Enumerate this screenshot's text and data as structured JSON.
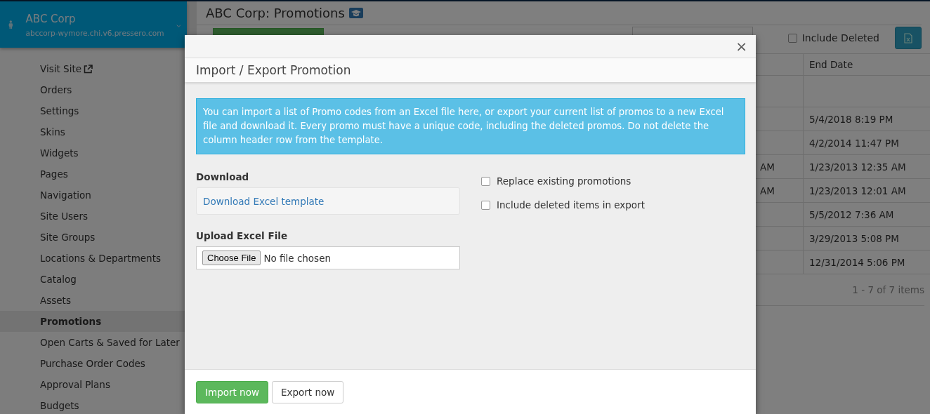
{
  "sidebar": {
    "account": {
      "name": "ABC Corp",
      "domain": "abccorp-wymore.chi.v6.pressero.com"
    },
    "items": [
      {
        "label": "Visit Site",
        "kind": "external",
        "selected": false
      },
      {
        "label": "Orders",
        "kind": "plain",
        "selected": false
      },
      {
        "label": "Settings",
        "kind": "plain",
        "selected": false
      },
      {
        "label": "Skins",
        "kind": "plain",
        "selected": false
      },
      {
        "label": "Widgets",
        "kind": "plain",
        "selected": false
      },
      {
        "label": "Pages",
        "kind": "plain",
        "selected": false
      },
      {
        "label": "Navigation",
        "kind": "plain",
        "selected": false
      },
      {
        "label": "Site Users",
        "kind": "plain",
        "selected": false
      },
      {
        "label": "Site Groups",
        "kind": "plain",
        "selected": false
      },
      {
        "label": "Locations & Departments",
        "kind": "plain",
        "selected": false
      },
      {
        "label": "Catalog",
        "kind": "plain",
        "selected": false
      },
      {
        "label": "Assets",
        "kind": "plain",
        "selected": false
      },
      {
        "label": "Promotions",
        "kind": "plain",
        "selected": true
      },
      {
        "label": "Open Carts & Saved for Later",
        "kind": "plain",
        "selected": false
      },
      {
        "label": "Purchase Order Codes",
        "kind": "plain",
        "selected": false
      },
      {
        "label": "Approval Plans",
        "kind": "plain",
        "selected": false
      },
      {
        "label": "Budgets",
        "kind": "plain",
        "selected": false
      }
    ]
  },
  "page": {
    "title": "ABC Corp: Promotions",
    "include_deleted": {
      "label": "Include Deleted",
      "checked": false
    }
  },
  "table": {
    "columns": [
      "End Date"
    ],
    "rows": [
      {
        "column_1": "",
        "end_date": ""
      },
      {
        "column_1": "",
        "end_date": "5/4/2018 8:19 PM"
      },
      {
        "column_1": "",
        "end_date": "4/2/2014 11:47 PM"
      },
      {
        "column_1": "AM",
        "end_date": "1/23/2013 12:35 AM"
      },
      {
        "column_1": "AM",
        "end_date": "1/23/2013 12:01 AM"
      },
      {
        "column_1": "",
        "end_date": "5/5/2012 7:36 AM"
      },
      {
        "column_1": "",
        "end_date": "3/29/2013 5:08 PM"
      },
      {
        "column_1": "",
        "end_date": "12/31/2014 5:06 PM"
      }
    ],
    "pager": "1 - 7 of 7 items"
  },
  "modal": {
    "title": "Import / Export Promotion",
    "close": "×",
    "info": "You can import a list of Promo codes from an Excel file here, or export your current list of promos to a new Excel file and download it. Every promo must have a unique code, including the deleted promos. Do not delete the column header row from the template.",
    "download_label": "Download",
    "download_link": "Download Excel template",
    "options": [
      {
        "label": "Replace existing promotions",
        "checked": false
      },
      {
        "label": "Include deleted items in export",
        "checked": false
      }
    ],
    "upload_label": "Upload Excel File",
    "file_button": "Choose File",
    "file_status": "No file chosen",
    "buttons": [
      {
        "label": "Import now",
        "kind": "primary"
      },
      {
        "label": "Export now",
        "kind": "default"
      }
    ]
  }
}
